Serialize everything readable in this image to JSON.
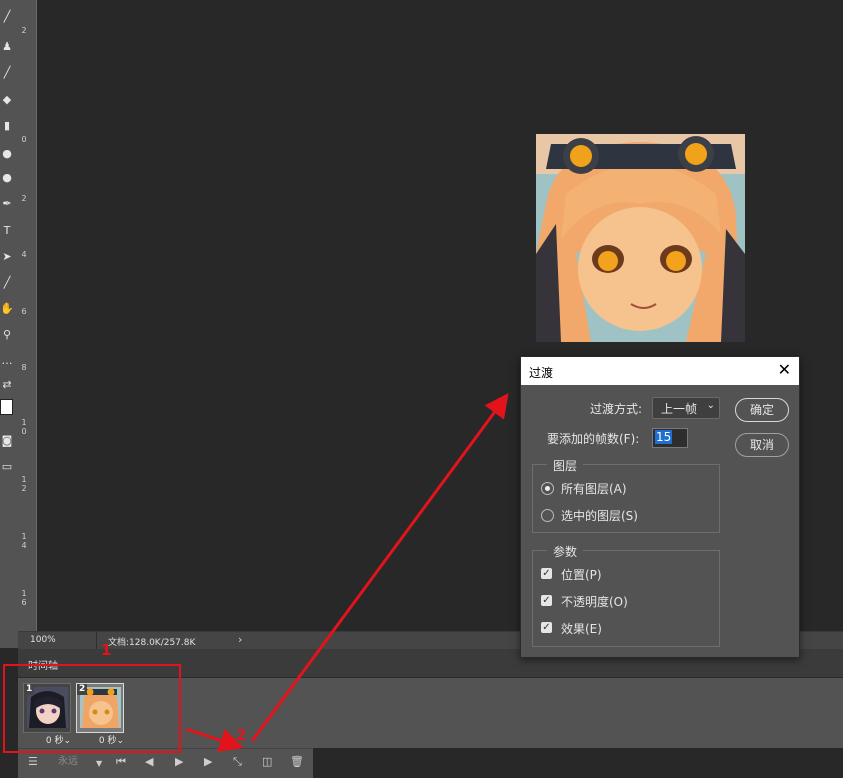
{
  "status": {
    "zoom": "100%",
    "doc_info": "文档:128.0K/257.8K"
  },
  "timeline": {
    "tab": "时间轴",
    "frames": [
      {
        "number": "1",
        "delay": "0 秒"
      },
      {
        "number": "2",
        "delay": "0 秒"
      }
    ],
    "loop_label": "永远"
  },
  "ruler_marks": [
    "2",
    "0",
    "2",
    "4",
    "6",
    "8",
    "1\n0",
    "1\n2",
    "1\n4",
    "1\n6"
  ],
  "dialog": {
    "title": "过渡",
    "method_label": "过渡方式:",
    "method_value": "上一帧",
    "frames_label": "要添加的帧数(F):",
    "frames_value": "15",
    "ok": "确定",
    "cancel": "取消",
    "layers_group": "图层",
    "layers_options": [
      {
        "label": "所有图层(A)",
        "selected": true
      },
      {
        "label": "选中的图层(S)",
        "selected": false
      }
    ],
    "params_group": "参数",
    "params_options": [
      {
        "label": "位置(P)",
        "checked": true
      },
      {
        "label": "不透明度(O)",
        "checked": true
      },
      {
        "label": "效果(E)",
        "checked": true
      }
    ]
  },
  "annotations": {
    "one": "1",
    "two": "2",
    "color": "#e3131b"
  }
}
